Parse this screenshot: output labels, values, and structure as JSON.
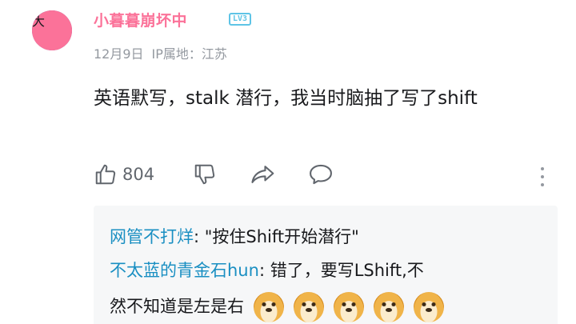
{
  "comment": {
    "username": "小暮暮崩坏中",
    "level": "LV3",
    "avatar_badge": "大",
    "date": "12月9日",
    "ip_location": "IP属地：江苏",
    "content": "英语默写，stalk  潜行，我当时脑抽了写了shift",
    "like_count": "804",
    "icons": [
      "thumbs-up-icon",
      "thumbs-down-icon",
      "share-icon",
      "comment-icon",
      "more-vertical-icon"
    ]
  },
  "replies": [
    {
      "name": "网管不打烊",
      "text": ": \"按住Shift开始潜行\""
    },
    {
      "name": "不太蓝的青金石hun",
      "text": ": 错了，要写LShift,不"
    },
    {
      "name": "",
      "text": "然不知道是左是右"
    }
  ],
  "emoji": {
    "name": "doge",
    "count": 5
  },
  "colors": {
    "username": "#fb7299",
    "level_badge": "#5ec4e6",
    "reply_name": "#1a8fc2",
    "reply_bg": "#f6f7f8",
    "meta": "#9499a0"
  }
}
